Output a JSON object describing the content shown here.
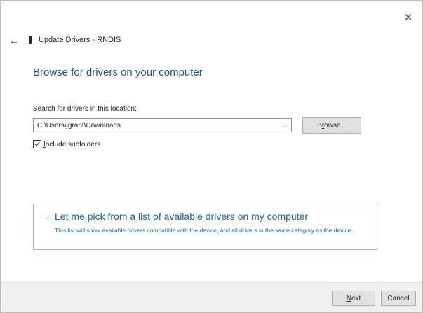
{
  "window": {
    "title": "Update Drivers - RNDIS",
    "close_glyph": "✕",
    "back_glyph": "←"
  },
  "main": {
    "heading": "Browse for drivers on your computer",
    "search_label": "Search for drivers in this location:",
    "path_value": "C:\\Users\\jgrant\\Downloads",
    "browse_label_pre": "B",
    "browse_label_mnemonic": "r",
    "browse_label_post": "owse...",
    "include_pre": "",
    "include_mnemonic": "I",
    "include_post": "nclude subfolders",
    "include_checked": true
  },
  "pick_option": {
    "arrow": "→",
    "title_mnemonic": "L",
    "title_rest": "et me pick from a list of available drivers on my computer",
    "description": "This list will show available drivers compatible with the device, and all drivers in the same category as the device."
  },
  "footer": {
    "next_mnemonic": "N",
    "next_rest": "ext",
    "cancel_label": "Cancel"
  },
  "colors": {
    "heading": "#1f4e8a",
    "link": "#1a5fb4",
    "footer_bg": "#f0f0f0"
  },
  "icons": {
    "close": "close-icon",
    "back": "back-arrow-icon",
    "device": "device-icon",
    "dropdown": "chevron-down-icon",
    "pick_arrow": "right-arrow-icon"
  }
}
